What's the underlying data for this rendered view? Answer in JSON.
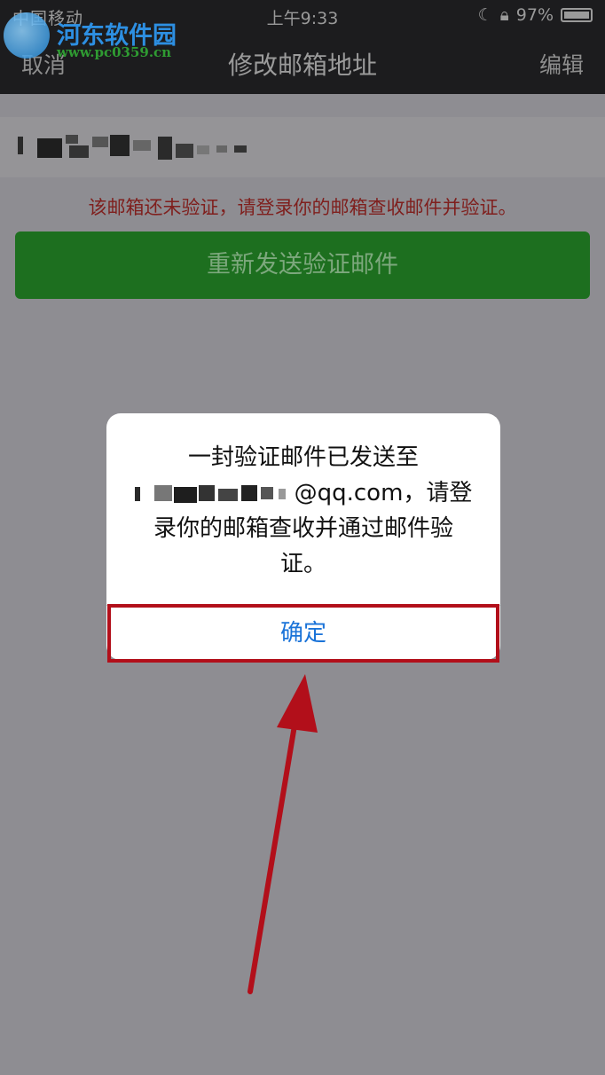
{
  "status": {
    "carrier": "中国移动",
    "time": "上午9:33",
    "battery": "97%"
  },
  "nav": {
    "cancel": "取消",
    "title": "修改邮箱地址",
    "edit": "编辑"
  },
  "watermark": {
    "title": "河东软件园",
    "url": "www.pc0359.cn"
  },
  "email": {
    "masked": true
  },
  "warning": "该邮箱还未验证，请登录你的邮箱查收邮件并验证。",
  "resend_button": "重新发送验证邮件",
  "dialog": {
    "line1": "一封验证邮件已发送至",
    "email_suffix": "@qq.com，请登",
    "line3": "录你的邮箱查收并通过邮件验",
    "line4": "证。",
    "confirm": "确定"
  },
  "colors": {
    "annotation": "#b20f1a",
    "resend_bg": "#1d6f1f",
    "confirm_text": "#1a73d8"
  }
}
